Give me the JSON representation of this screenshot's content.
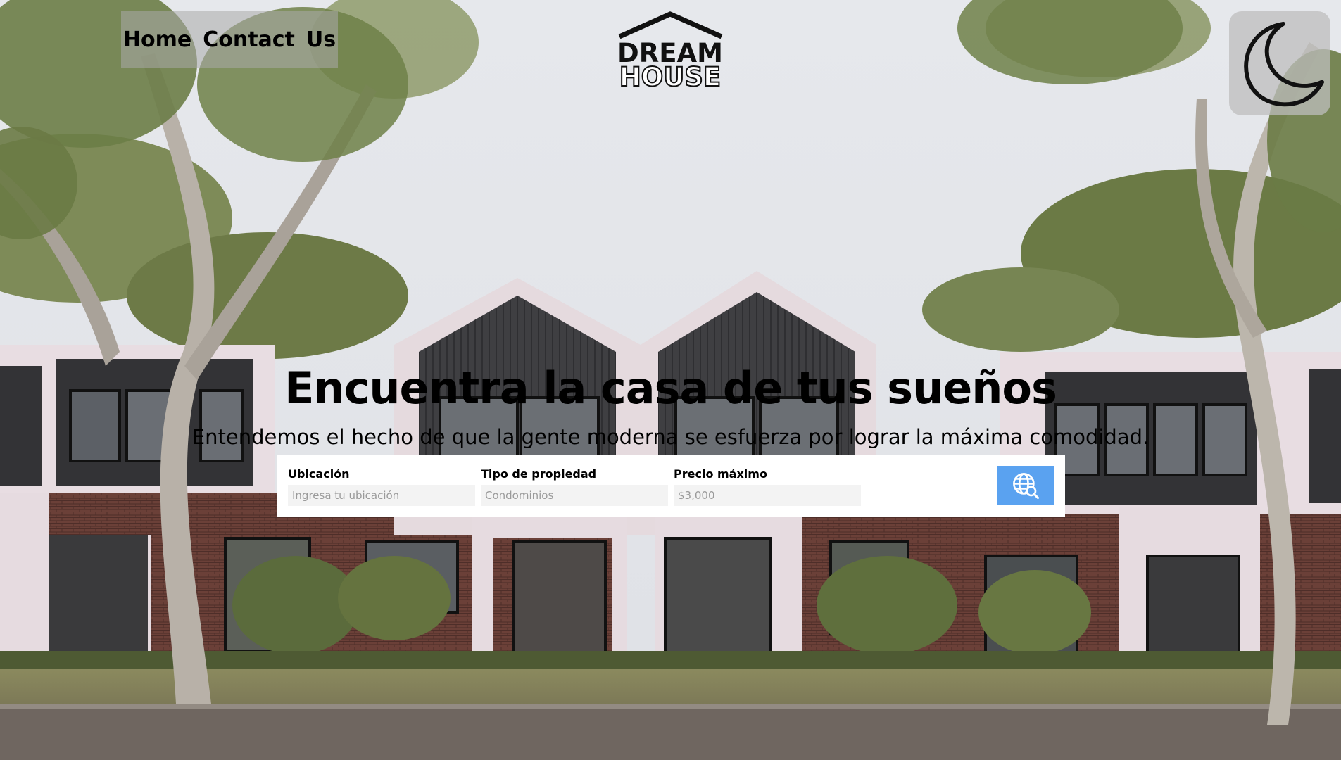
{
  "nav": {
    "items": [
      "Home",
      "Contact",
      "Us"
    ]
  },
  "logo": {
    "line1": "DREAM",
    "line2": "HOUSE"
  },
  "theme_toggle": {
    "icon": "moon-icon"
  },
  "hero": {
    "title": "Encuentra la casa de tus sueños",
    "subtitle": "Entendemos el hecho de que la gente moderna se esfuerza por lograr la máxima comodidad."
  },
  "search": {
    "fields": [
      {
        "label": "Ubicación",
        "placeholder": "Ingresa tu ubicación",
        "value": ""
      },
      {
        "label": "Tipo de propiedad",
        "placeholder": "Condominios",
        "value": ""
      },
      {
        "label": "Precio máximo",
        "placeholder": "$3,000",
        "value": ""
      }
    ],
    "button_icon": "globe-search-icon",
    "button_color": "#5aa2f0"
  }
}
